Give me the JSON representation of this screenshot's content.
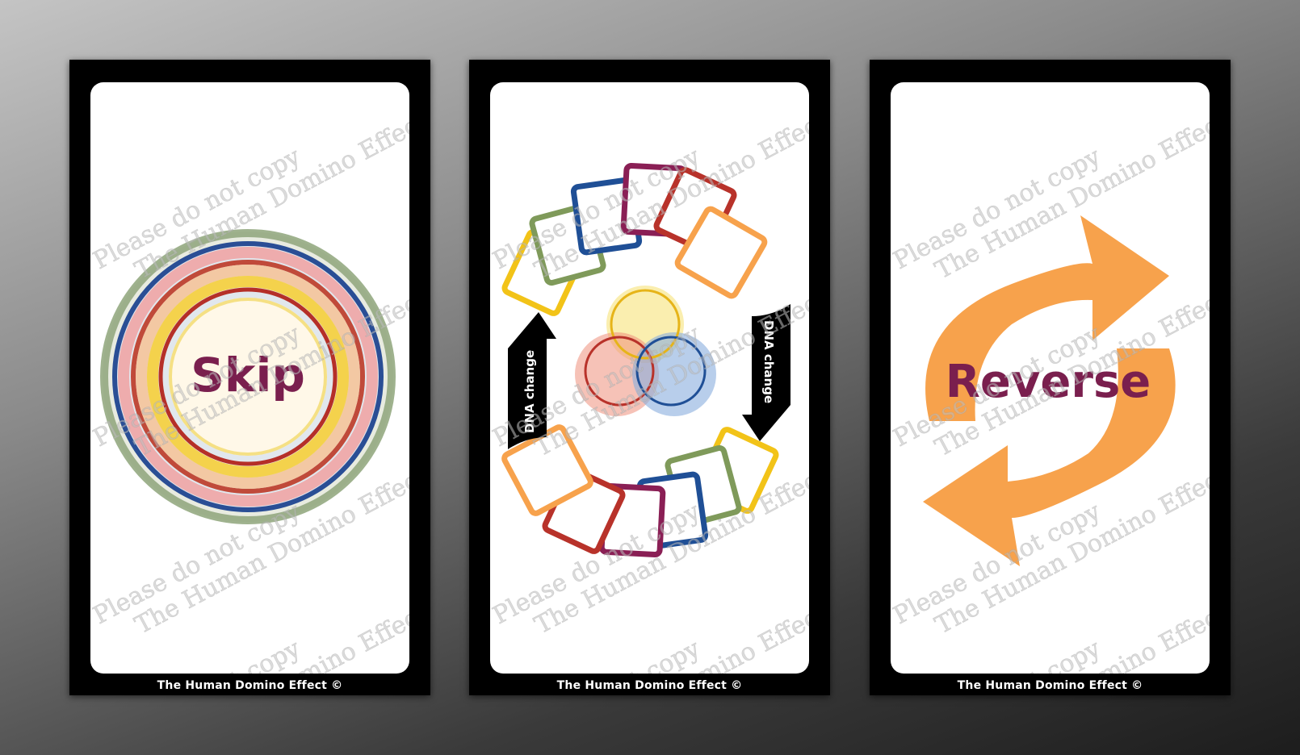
{
  "cards": [
    {
      "id": "skip",
      "label": "Skip",
      "footer": "The Human Domino Effect ©"
    },
    {
      "id": "dna",
      "label_left": "DNA change",
      "label_right": "DNA change",
      "footer": "The Human Domino Effect ©"
    },
    {
      "id": "reverse",
      "label": "Reverse",
      "footer": "The Human Domino Effect ©"
    }
  ],
  "watermark": {
    "line1": "Please do not copy",
    "line2": "The Human Domino Effect"
  },
  "colors": {
    "background_dark": "#1d1d1d",
    "card_border": "#000000",
    "label_text": "#7a1f4e",
    "orange": "#f7a24c",
    "red": "#b8322a",
    "yellow": "#f2c318",
    "green": "#7f9a5a",
    "blue": "#1f4f96",
    "purple": "#8a1f55"
  }
}
